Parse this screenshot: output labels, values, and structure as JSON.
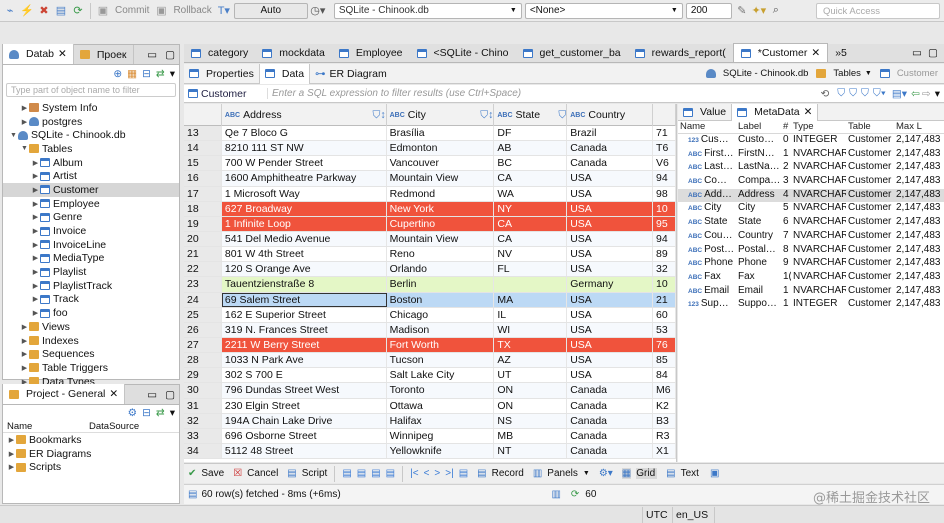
{
  "toolbar": {
    "commit_label": "Commit",
    "rollback_label": "Rollback",
    "mode_value": "Auto",
    "connection_value": "SQLite - Chinook.db",
    "schema_value": "<None>",
    "limit_value": "200",
    "quick_access_placeholder": "Quick Access"
  },
  "navigator": {
    "tabs": [
      "Datab",
      "Проек"
    ],
    "filter_placeholder": "Type part of object name to filter",
    "tree": [
      {
        "label": "System Info",
        "level": 2,
        "icon": "info",
        "arrow": "▶"
      },
      {
        "label": "postgres",
        "level": 2,
        "icon": "db",
        "arrow": "▶"
      },
      {
        "label": "SQLite - Chinook.db",
        "level": 1,
        "icon": "db",
        "arrow": "▼"
      },
      {
        "label": "Tables",
        "level": 2,
        "icon": "fold",
        "arrow": "▼"
      },
      {
        "label": "Album",
        "level": 3,
        "icon": "tbl",
        "arrow": "▶"
      },
      {
        "label": "Artist",
        "level": 3,
        "icon": "tbl",
        "arrow": "▶"
      },
      {
        "label": "Customer",
        "level": 3,
        "icon": "tbl",
        "arrow": "▶",
        "selected": true
      },
      {
        "label": "Employee",
        "level": 3,
        "icon": "tbl",
        "arrow": "▶"
      },
      {
        "label": "Genre",
        "level": 3,
        "icon": "tbl",
        "arrow": "▶"
      },
      {
        "label": "Invoice",
        "level": 3,
        "icon": "tbl",
        "arrow": "▶"
      },
      {
        "label": "InvoiceLine",
        "level": 3,
        "icon": "tbl",
        "arrow": "▶"
      },
      {
        "label": "MediaType",
        "level": 3,
        "icon": "tbl",
        "arrow": "▶"
      },
      {
        "label": "Playlist",
        "level": 3,
        "icon": "tbl",
        "arrow": "▶"
      },
      {
        "label": "PlaylistTrack",
        "level": 3,
        "icon": "tbl",
        "arrow": "▶"
      },
      {
        "label": "Track",
        "level": 3,
        "icon": "tbl",
        "arrow": "▶"
      },
      {
        "label": "foo",
        "level": 3,
        "icon": "tbl",
        "arrow": "▶"
      },
      {
        "label": "Views",
        "level": 2,
        "icon": "fold",
        "arrow": "▶"
      },
      {
        "label": "Indexes",
        "level": 2,
        "icon": "fold",
        "arrow": "▶"
      },
      {
        "label": "Sequences",
        "level": 2,
        "icon": "fold",
        "arrow": "▶"
      },
      {
        "label": "Table Triggers",
        "level": 2,
        "icon": "fold",
        "arrow": "▶"
      },
      {
        "label": "Data Types",
        "level": 2,
        "icon": "fold",
        "arrow": "▶"
      }
    ]
  },
  "project": {
    "tab": "Project - General",
    "col_name": "Name",
    "col_datasource": "DataSource",
    "items": [
      "Bookmarks",
      "ER Diagrams",
      "Scripts"
    ]
  },
  "editor_tabs": [
    "category",
    "mockdata",
    "Employee",
    "<SQLite - Chino",
    "get_customer_ba",
    "rewards_report(",
    "*Customer",
    "»5"
  ],
  "sub_tabs": [
    "Properties",
    "Data",
    "ER Diagram"
  ],
  "sub_right": {
    "conn": "SQLite - Chinook.db",
    "tables": "Tables",
    "table": "Customer"
  },
  "filter": {
    "entity": "Customer",
    "placeholder": "Enter a SQL expression to filter results (use Ctrl+Space)"
  },
  "grid": {
    "columns": [
      "Address",
      "City",
      "State",
      "Country"
    ],
    "rows": [
      {
        "n": "13",
        "a": "Qe 7 Bloco G",
        "c": "Brasília",
        "s": "DF",
        "co": "Brazil",
        "x": "71",
        "k": ""
      },
      {
        "n": "14",
        "a": "8210 111 ST NW",
        "c": "Edmonton",
        "s": "AB",
        "co": "Canada",
        "x": "T6",
        "k": ""
      },
      {
        "n": "15",
        "a": "700 W Pender Street",
        "c": "Vancouver",
        "s": "BC",
        "co": "Canada",
        "x": "V6",
        "k": ""
      },
      {
        "n": "16",
        "a": "1600 Amphitheatre Parkway",
        "c": "Mountain View",
        "s": "CA",
        "co": "USA",
        "x": "94",
        "k": ""
      },
      {
        "n": "17",
        "a": "1 Microsoft Way",
        "c": "Redmond",
        "s": "WA",
        "co": "USA",
        "x": "98",
        "k": ""
      },
      {
        "n": "18",
        "a": "627 Broadway",
        "c": "New York",
        "s": "NY",
        "co": "USA",
        "x": "10",
        "k": "red"
      },
      {
        "n": "19",
        "a": "1 Infinite Loop",
        "c": "Cupertino",
        "s": "CA",
        "co": "USA",
        "x": "95",
        "k": "red"
      },
      {
        "n": "20",
        "a": "541 Del Medio Avenue",
        "c": "Mountain View",
        "s": "CA",
        "co": "USA",
        "x": "94",
        "k": ""
      },
      {
        "n": "21",
        "a": "801 W 4th Street",
        "c": "Reno",
        "s": "NV",
        "co": "USA",
        "x": "89",
        "k": ""
      },
      {
        "n": "22",
        "a": "120 S Orange Ave",
        "c": "Orlando",
        "s": "FL",
        "co": "USA",
        "x": "32",
        "k": ""
      },
      {
        "n": "23",
        "a": "Tauentzienstraße 8",
        "c": "Berlin",
        "s": "",
        "co": "Germany",
        "x": "10",
        "k": "grn"
      },
      {
        "n": "24",
        "a": "69 Salem Street",
        "c": "Boston",
        "s": "MA",
        "co": "USA",
        "x": "21",
        "k": "cur"
      },
      {
        "n": "25",
        "a": "162 E Superior Street",
        "c": "Chicago",
        "s": "IL",
        "co": "USA",
        "x": "60",
        "k": ""
      },
      {
        "n": "26",
        "a": "319 N. Frances Street",
        "c": "Madison",
        "s": "WI",
        "co": "USA",
        "x": "53",
        "k": ""
      },
      {
        "n": "27",
        "a": "2211 W Berry Street",
        "c": "Fort Worth",
        "s": "TX",
        "co": "USA",
        "x": "76",
        "k": "red"
      },
      {
        "n": "28",
        "a": "1033 N Park Ave",
        "c": "Tucson",
        "s": "AZ",
        "co": "USA",
        "x": "85",
        "k": ""
      },
      {
        "n": "29",
        "a": "302 S 700 E",
        "c": "Salt Lake City",
        "s": "UT",
        "co": "USA",
        "x": "84",
        "k": ""
      },
      {
        "n": "30",
        "a": "796 Dundas Street West",
        "c": "Toronto",
        "s": "ON",
        "co": "Canada",
        "x": "M6",
        "k": ""
      },
      {
        "n": "31",
        "a": "230 Elgin Street",
        "c": "Ottawa",
        "s": "ON",
        "co": "Canada",
        "x": "K2",
        "k": ""
      },
      {
        "n": "32",
        "a": "194A Chain Lake Drive",
        "c": "Halifax",
        "s": "NS",
        "co": "Canada",
        "x": "B3",
        "k": ""
      },
      {
        "n": "33",
        "a": "696 Osborne Street",
        "c": "Winnipeg",
        "s": "MB",
        "co": "Canada",
        "x": "R3",
        "k": ""
      },
      {
        "n": "34",
        "a": "5112 48 Street",
        "c": "Yellowknife",
        "s": "NT",
        "co": "Canada",
        "x": "X1",
        "k": ""
      }
    ]
  },
  "metadata": {
    "tabs": [
      "Value",
      "MetaData"
    ],
    "headers": [
      "Name",
      "Label",
      "#",
      "Type",
      "Table Name",
      "Max L"
    ],
    "rows": [
      {
        "name": "Cus…",
        "label": "Custo…",
        "idx": "0",
        "type": "INTEGER",
        "table": "Customer",
        "max": "2,147,483",
        "num": true
      },
      {
        "name": "First…",
        "label": "FirstN…",
        "idx": "1",
        "type": "NVARCHAR",
        "table": "Customer",
        "max": "2,147,483"
      },
      {
        "name": "Last…",
        "label": "LastNa…",
        "idx": "2",
        "type": "NVARCHAR",
        "table": "Customer",
        "max": "2,147,483"
      },
      {
        "name": "Co…",
        "label": "Compa…",
        "idx": "3",
        "type": "NVARCHAR",
        "table": "Customer",
        "max": "2,147,483"
      },
      {
        "name": "Add…",
        "label": "Address",
        "idx": "4",
        "type": "NVARCHAR",
        "table": "Customer",
        "max": "2,147,483",
        "sel": true
      },
      {
        "name": "City",
        "label": "City",
        "idx": "5",
        "type": "NVARCHAR",
        "table": "Customer",
        "max": "2,147,483"
      },
      {
        "name": "State",
        "label": "State",
        "idx": "6",
        "type": "NVARCHAR",
        "table": "Customer",
        "max": "2,147,483"
      },
      {
        "name": "Cou…",
        "label": "Country",
        "idx": "7",
        "type": "NVARCHAR",
        "table": "Customer",
        "max": "2,147,483"
      },
      {
        "name": "Post…",
        "label": "Postal…",
        "idx": "8",
        "type": "NVARCHAR",
        "table": "Customer",
        "max": "2,147,483"
      },
      {
        "name": "Phone",
        "label": "Phone",
        "idx": "9",
        "type": "NVARCHAR",
        "table": "Customer",
        "max": "2,147,483"
      },
      {
        "name": "Fax",
        "label": "Fax",
        "idx": "1(",
        "type": "NVARCHAR",
        "table": "Customer",
        "max": "2,147,483"
      },
      {
        "name": "Email",
        "label": "Email",
        "idx": "1",
        "type": "NVARCHAR",
        "table": "Customer",
        "max": "2,147,483"
      },
      {
        "name": "Sup…",
        "label": "Suppo…",
        "idx": "1",
        "type": "INTEGER",
        "table": "Customer",
        "max": "2,147,483",
        "num": true
      }
    ]
  },
  "bottom_toolbar": {
    "save": "Save",
    "cancel": "Cancel",
    "script": "Script",
    "record": "Record",
    "panels": "Panels",
    "grid": "Grid",
    "text": "Text"
  },
  "status": {
    "fetched": "60 row(s) fetched - 8ms (+6ms)",
    "count": "60"
  },
  "statusbar": {
    "tz": "UTC",
    "locale": "en_US"
  },
  "watermark": "@稀土掘金技术社区"
}
